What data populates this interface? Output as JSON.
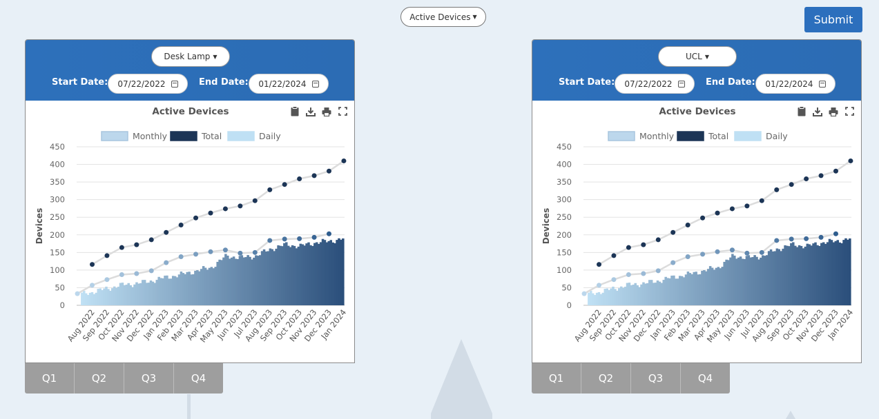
{
  "top": {
    "metric_select": "Active Devices",
    "submit_label": "Submit"
  },
  "labels": {
    "start_date": "Start Date:",
    "end_date": "End Date:"
  },
  "panels": [
    {
      "device": "Desk Lamp",
      "start_date": "07/22/2022",
      "end_date": "01/22/2024"
    },
    {
      "device": "UCL",
      "start_date": "07/22/2022",
      "end_date": "01/22/2024"
    }
  ],
  "tabs": [
    "Q1",
    "Q2",
    "Q3",
    "Q4"
  ],
  "colors": {
    "accent": "#2c6fbd",
    "total": "#1c3556",
    "monthly": "#bcd7ec",
    "daily_start": "#bfe0f4",
    "daily_end": "#2b4f7b"
  },
  "icons": [
    "clipboard-icon",
    "download-icon",
    "print-icon",
    "fullscreen-icon",
    "calendar-icon"
  ],
  "chart_data": {
    "type": "line",
    "title": "Active Devices",
    "ylabel": "Devices",
    "xlabel": "",
    "ylim": [
      0,
      450
    ],
    "yticks": [
      0,
      50,
      100,
      150,
      200,
      250,
      300,
      350,
      400,
      450
    ],
    "categories": [
      "Aug 2022",
      "Sep 2022",
      "Oct 2022",
      "Nov 2022",
      "Dec 2022",
      "Jan 2023",
      "Feb 2023",
      "Mar 2023",
      "Apr 2023",
      "May 2023",
      "Jun 2023",
      "Jul 2023",
      "Aug 2023",
      "Sep 2023",
      "Oct 2023",
      "Nov 2023",
      "Dec 2023",
      "Jan 2024"
    ],
    "legend": [
      "Monthly",
      "Total",
      "Daily"
    ],
    "legend_position": "top",
    "grid": true,
    "series": [
      {
        "name": "Total",
        "x": [
          "Aug 2022",
          "Sep 2022",
          "Oct 2022",
          "Nov 2022",
          "Dec 2022",
          "Jan 2023",
          "Feb 2023",
          "Mar 2023",
          "Apr 2023",
          "May 2023",
          "Jun 2023",
          "Jul 2023",
          "Aug 2023",
          "Sep 2023",
          "Oct 2023",
          "Nov 2023",
          "Dec 2023",
          "Jan 2024"
        ],
        "values": [
          116,
          141,
          164,
          172,
          186,
          207,
          228,
          248,
          262,
          274,
          282,
          297,
          328,
          343,
          359,
          368,
          381,
          410
        ]
      },
      {
        "name": "Monthly",
        "x": [
          "Jul 2022",
          "Aug 2022",
          "Sep 2022",
          "Oct 2022",
          "Nov 2022",
          "Dec 2022",
          "Jan 2023",
          "Feb 2023",
          "Mar 2023",
          "Apr 2023",
          "May 2023",
          "Jun 2023",
          "Jul 2023",
          "Aug 2023",
          "Sep 2023",
          "Oct 2023",
          "Nov 2023",
          "Dec 2023"
        ],
        "values": [
          33,
          57,
          73,
          87,
          90,
          98,
          121,
          138,
          145,
          152,
          157,
          148,
          150,
          184,
          188,
          189,
          193,
          203
        ]
      },
      {
        "name": "Daily",
        "x": [
          "Jul 2022",
          "Aug 2022",
          "Sep 2022",
          "Oct 2022",
          "Nov 2022",
          "Dec 2022",
          "Jan 2023",
          "Feb 2023",
          "Mar 2023",
          "Apr 2023",
          "May 2023",
          "Jun 2023",
          "Jul 2023",
          "Aug 2023",
          "Sep 2023",
          "Oct 2023",
          "Nov 2023",
          "Dec 2023",
          "Jan 2024"
        ],
        "values": [
          30,
          38,
          48,
          58,
          62,
          70,
          80,
          88,
          98,
          108,
          140,
          135,
          140,
          160,
          172,
          168,
          178,
          182,
          190
        ]
      }
    ]
  }
}
